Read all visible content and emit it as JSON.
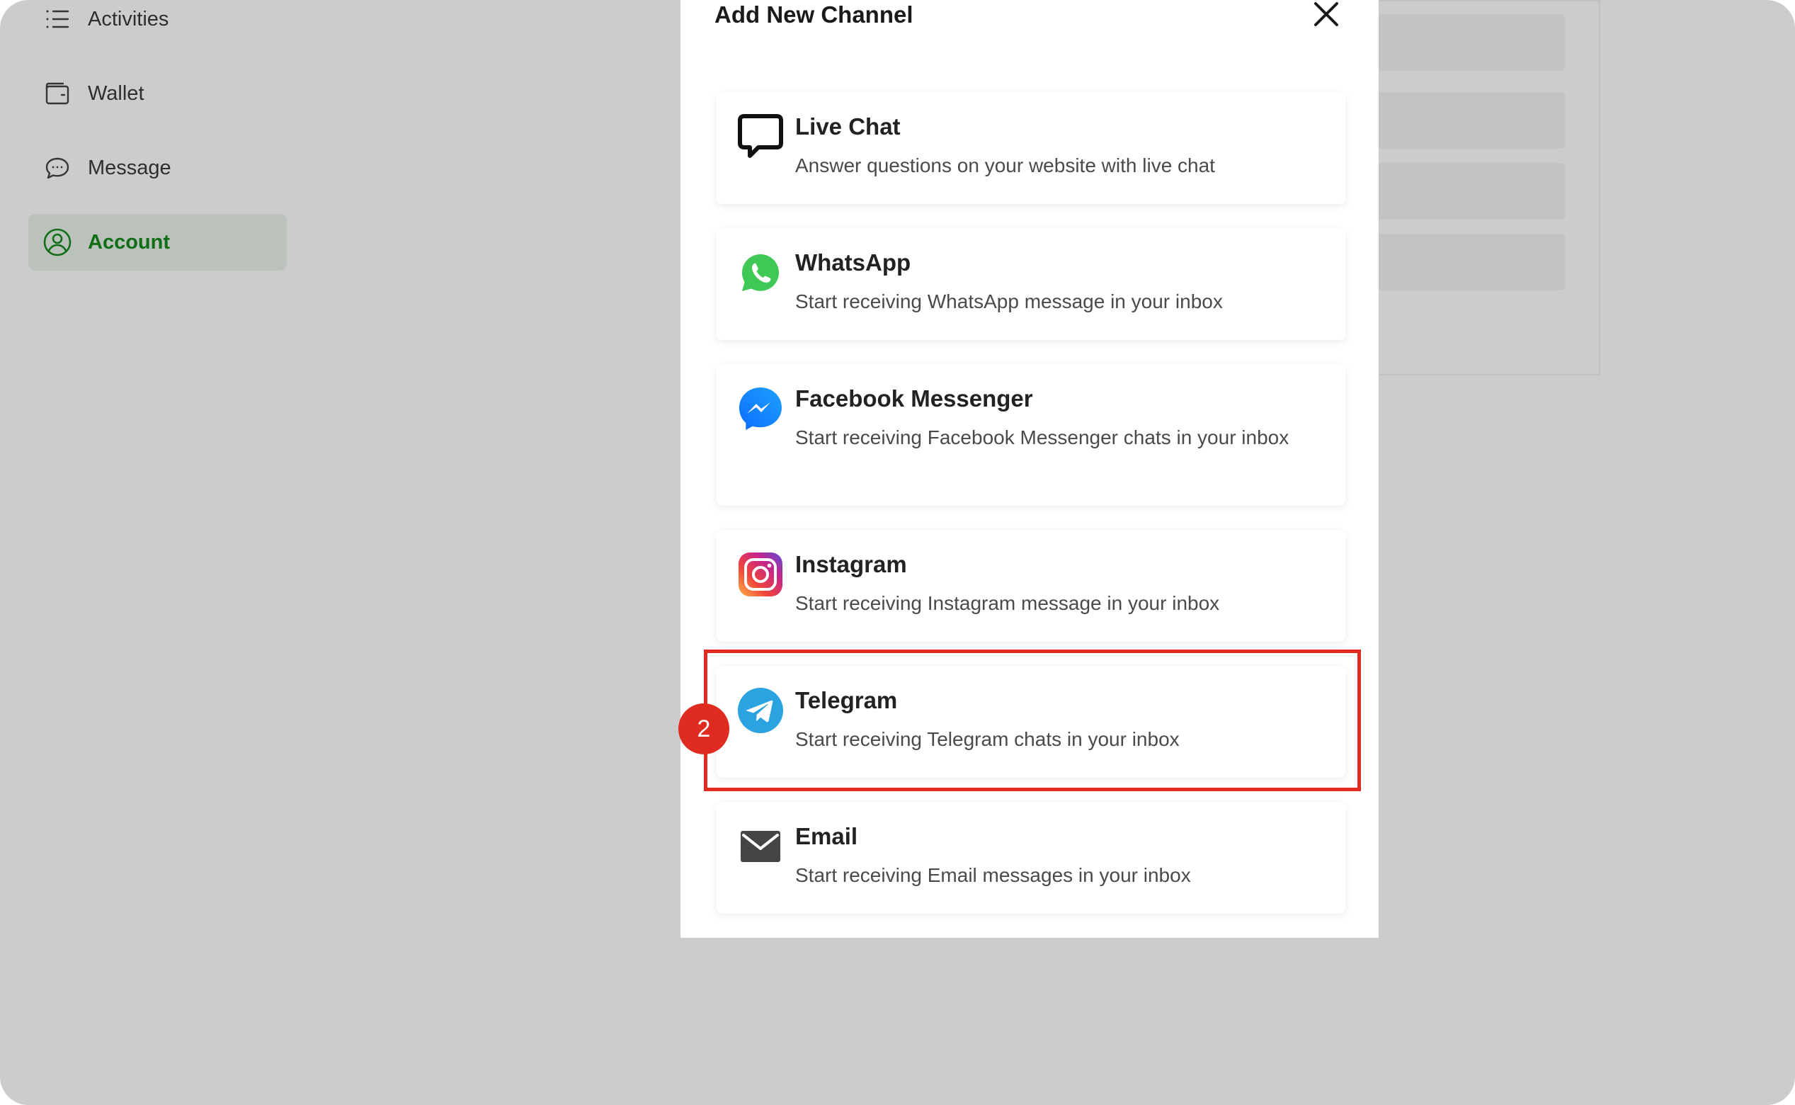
{
  "sidebar": {
    "items": [
      {
        "label": "Activities",
        "icon": "list-icon",
        "active": false
      },
      {
        "label": "Wallet",
        "icon": "wallet-icon",
        "active": false
      },
      {
        "label": "Message",
        "icon": "chat-bubble-icon",
        "active": false
      },
      {
        "label": "Account",
        "icon": "user-circle-icon",
        "active": true
      }
    ]
  },
  "modal": {
    "title": "Add New Channel",
    "close_icon": "close-icon",
    "channels": [
      {
        "name": "Live Chat",
        "description": "Answer questions on your website with live chat",
        "icon": "livechat-icon"
      },
      {
        "name": "WhatsApp",
        "description": "Start receiving WhatsApp message in your inbox",
        "icon": "whatsapp-icon"
      },
      {
        "name": "Facebook Messenger",
        "description": "Start receiving Facebook Messenger chats in your inbox",
        "icon": "messenger-icon"
      },
      {
        "name": "Instagram",
        "description": "Start receiving Instagram message in your inbox",
        "icon": "instagram-icon"
      },
      {
        "name": "Telegram",
        "description": "Start receiving Telegram chats in your inbox",
        "icon": "telegram-icon"
      },
      {
        "name": "Email",
        "description": "Start receiving Email messages in your inbox",
        "icon": "email-icon"
      }
    ]
  },
  "annotation": {
    "step_number": "2",
    "highlight_color": "#e02b20"
  },
  "colors": {
    "accent": "#158a1c",
    "overlay": "rgba(0,0,0,0.2)"
  }
}
